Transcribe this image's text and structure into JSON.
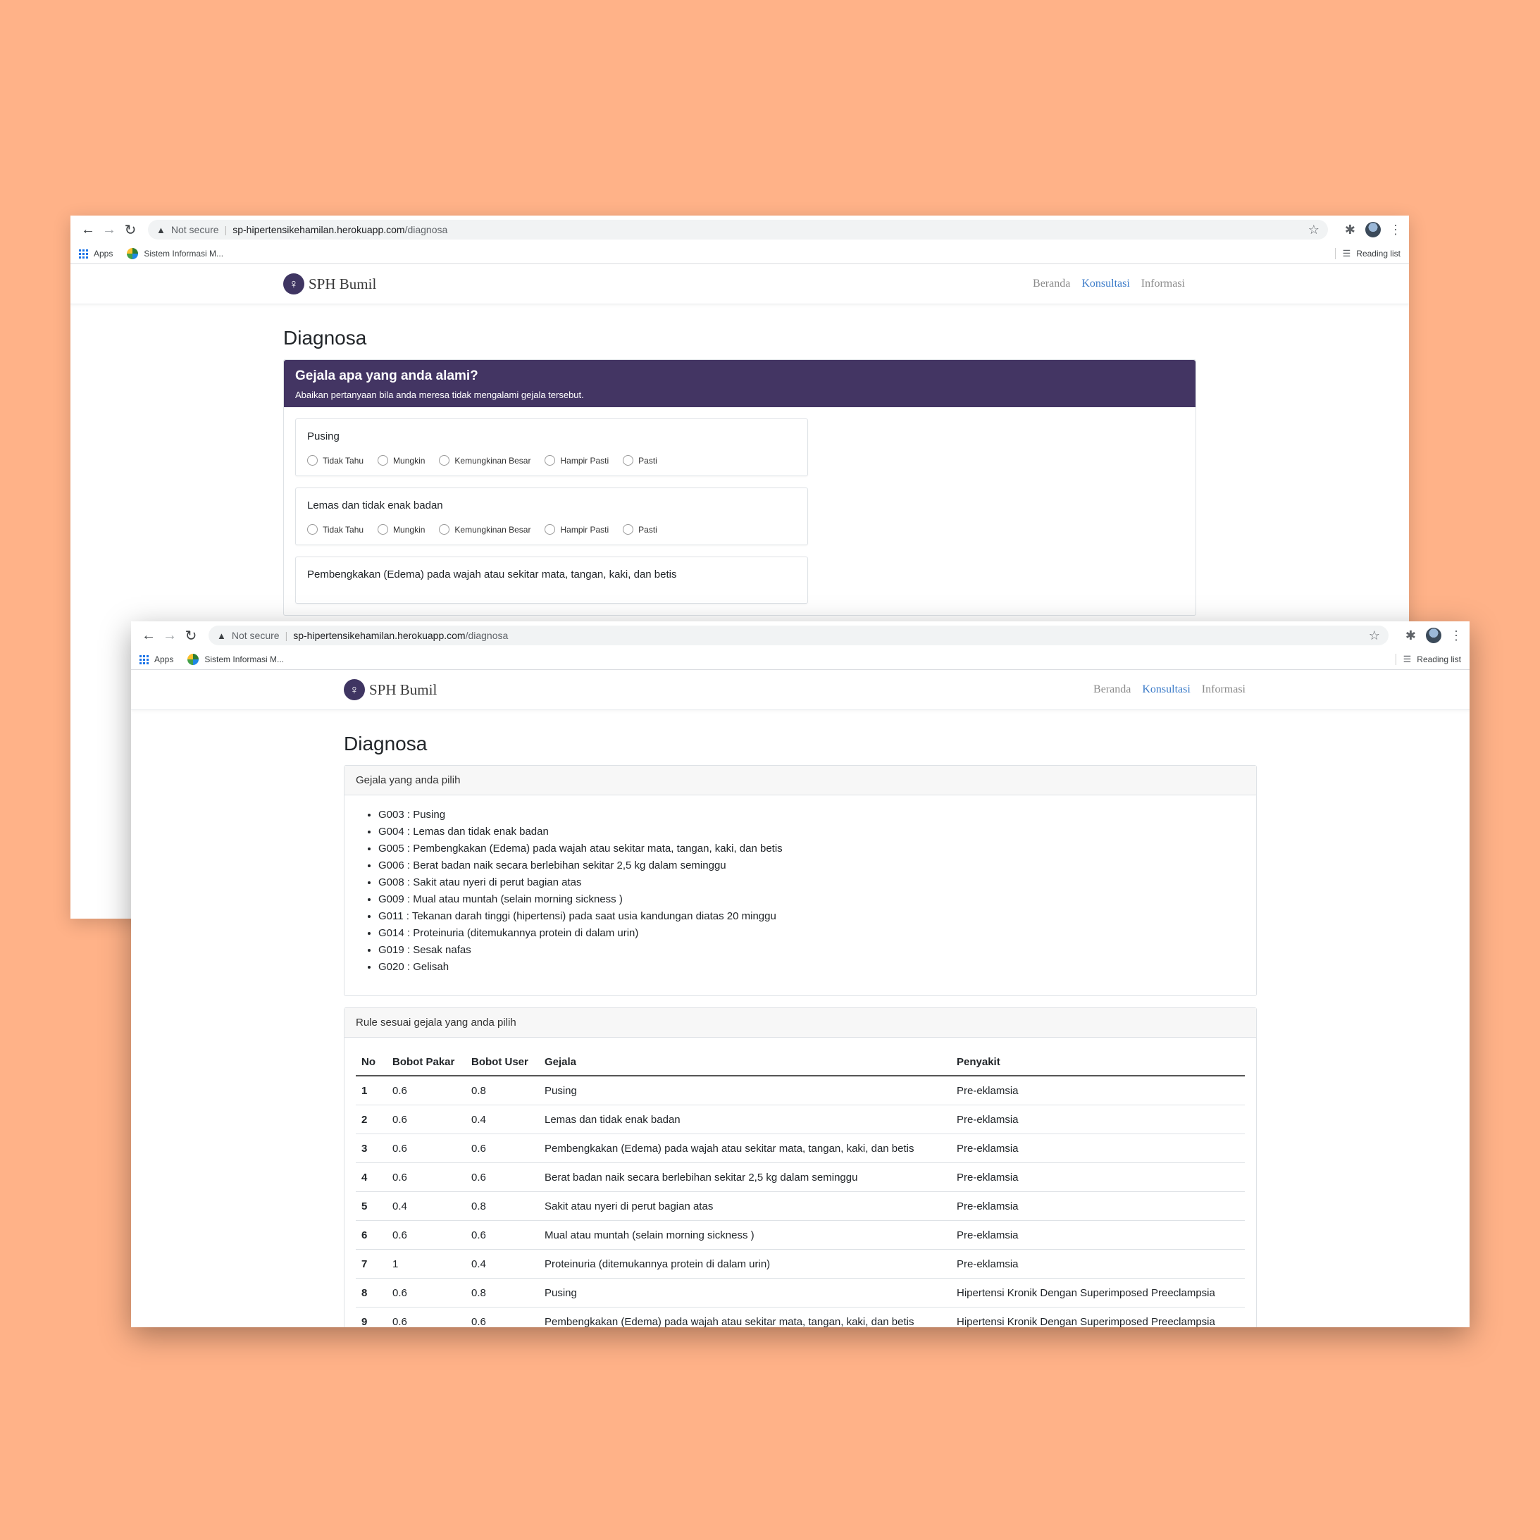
{
  "browser": {
    "not_secure": "Not secure",
    "url_host": "sp-hipertensikehamilan.herokuapp.com",
    "url_path": "/diagnosa",
    "bookmark_apps": "Apps",
    "bookmark_sis": "Sistem Informasi M...",
    "reading_list": "Reading list"
  },
  "site": {
    "brand": "SPH Bumil",
    "menu": {
      "beranda": "Beranda",
      "konsultasi": "Konsultasi",
      "informasi": "Informasi"
    },
    "active_menu": "Konsultasi"
  },
  "page_title": "Diagnosa",
  "question_form": {
    "title": "Gejala apa yang anda alami?",
    "subtitle": "Abaikan pertanyaan bila anda meresa tidak mengalami gejala tersebut.",
    "options": [
      "Tidak Tahu",
      "Mungkin",
      "Kemungkinan Besar",
      "Hampir Pasti",
      "Pasti"
    ],
    "questions": [
      "Pusing",
      "Lemas dan tidak enak badan",
      "Pembengkakan (Edema) pada wajah atau sekitar mata, tangan, kaki, dan betis"
    ]
  },
  "selected_symptoms": {
    "header": "Gejala yang anda pilih",
    "items": [
      "G003 : Pusing",
      "G004 : Lemas dan tidak enak badan",
      "G005 : Pembengkakan (Edema) pada wajah atau sekitar mata, tangan, kaki, dan betis",
      "G006 : Berat badan naik secara berlebihan sekitar 2,5 kg dalam seminggu",
      "G008 : Sakit atau nyeri di perut bagian atas",
      "G009 : Mual atau muntah (selain morning sickness )",
      "G011 : Tekanan darah tinggi (hipertensi) pada saat usia kandungan diatas 20 minggu",
      "G014 : Proteinuria (ditemukannya protein di dalam urin)",
      "G019 : Sesak nafas",
      "G020 : Gelisah"
    ]
  },
  "rules": {
    "header": "Rule sesuai gejala yang anda pilih",
    "columns": [
      "No",
      "Bobot Pakar",
      "Bobot User",
      "Gejala",
      "Penyakit"
    ],
    "rows": [
      [
        "1",
        "0.6",
        "0.8",
        "Pusing",
        "Pre-eklamsia"
      ],
      [
        "2",
        "0.6",
        "0.4",
        "Lemas dan tidak enak badan",
        "Pre-eklamsia"
      ],
      [
        "3",
        "0.6",
        "0.6",
        "Pembengkakan (Edema) pada wajah atau sekitar mata, tangan, kaki, dan betis",
        "Pre-eklamsia"
      ],
      [
        "4",
        "0.6",
        "0.6",
        "Berat badan naik secara berlebihan sekitar 2,5 kg dalam seminggu",
        "Pre-eklamsia"
      ],
      [
        "5",
        "0.4",
        "0.8",
        "Sakit atau nyeri di perut bagian atas",
        "Pre-eklamsia"
      ],
      [
        "6",
        "0.6",
        "0.6",
        "Mual atau muntah (selain morning sickness )",
        "Pre-eklamsia"
      ],
      [
        "7",
        "1",
        "0.4",
        "Proteinuria (ditemukannya protein di dalam urin)",
        "Pre-eklamsia"
      ],
      [
        "8",
        "0.6",
        "0.8",
        "Pusing",
        "Hipertensi Kronik Dengan Superimposed Preeclampsia"
      ],
      [
        "9",
        "0.6",
        "0.6",
        "Pembengkakan (Edema) pada wajah atau sekitar mata, tangan, kaki, dan betis",
        "Hipertensi Kronik Dengan Superimposed Preeclampsia"
      ]
    ]
  }
}
